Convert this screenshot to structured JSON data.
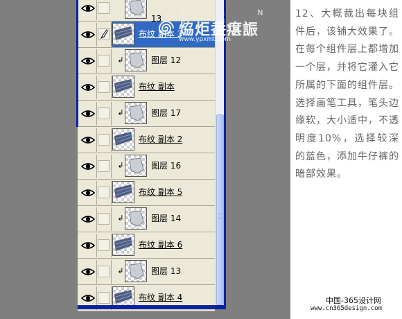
{
  "layers_panel": {
    "top_partial_label": "13",
    "layers": [
      {
        "name": "布纹 副本 3",
        "type": "base",
        "selected": true,
        "thumb": "fabric"
      },
      {
        "name": "图层 12",
        "type": "clipped",
        "selected": false,
        "thumb": "pants"
      },
      {
        "name": "布纹 副本",
        "type": "base",
        "selected": false,
        "thumb": "fabric"
      },
      {
        "name": "图层 17",
        "type": "clipped",
        "selected": false,
        "thumb": "pants"
      },
      {
        "name": "布纹 副本 2",
        "type": "base",
        "selected": false,
        "thumb": "fabric"
      },
      {
        "name": "图层 16",
        "type": "clipped",
        "selected": false,
        "thumb": "pants"
      },
      {
        "name": "布纹 副本 5",
        "type": "base",
        "selected": false,
        "thumb": "fabric"
      },
      {
        "name": "图层 14",
        "type": "clipped",
        "selected": false,
        "thumb": "pants"
      },
      {
        "name": "布纹 副本 6",
        "type": "base",
        "selected": false,
        "thumb": "fabric"
      },
      {
        "name": "图层 13",
        "type": "clipped",
        "selected": false,
        "thumb": "pants"
      },
      {
        "name": "布纹 副本 4",
        "type": "base",
        "selected": false,
        "thumb": "fabric"
      }
    ],
    "clip_glyph": "↲",
    "icons": {
      "visibility": "eye-icon",
      "link": "brush-icon",
      "clip": "clip-arrow-icon"
    }
  },
  "watermark": {
    "letters": "Y A N Y U",
    "title": "㶸炬盉瘎誫",
    "url": "www.ypxmt.com"
  },
  "instruction": {
    "text": "12、大概裁出每块组件后，该铺大效果了。在每个组件层上都增加一个层，并将它灌入它所属的下面的组件层。选择画笔工具，笔头边缘软，大小适中，不透明度10%，选择较深的蓝色，添加牛仔裤的暗部效果。"
  },
  "footer": {
    "site_name": "中国-365设计网",
    "site_url": "www.cn365design.com"
  },
  "colors": {
    "panel_bg": "#ece9d8",
    "selection": "#316ac5",
    "frame_blue": "#0a24a0",
    "page_gray": "#7f7f7f",
    "text_gray": "#666666"
  }
}
